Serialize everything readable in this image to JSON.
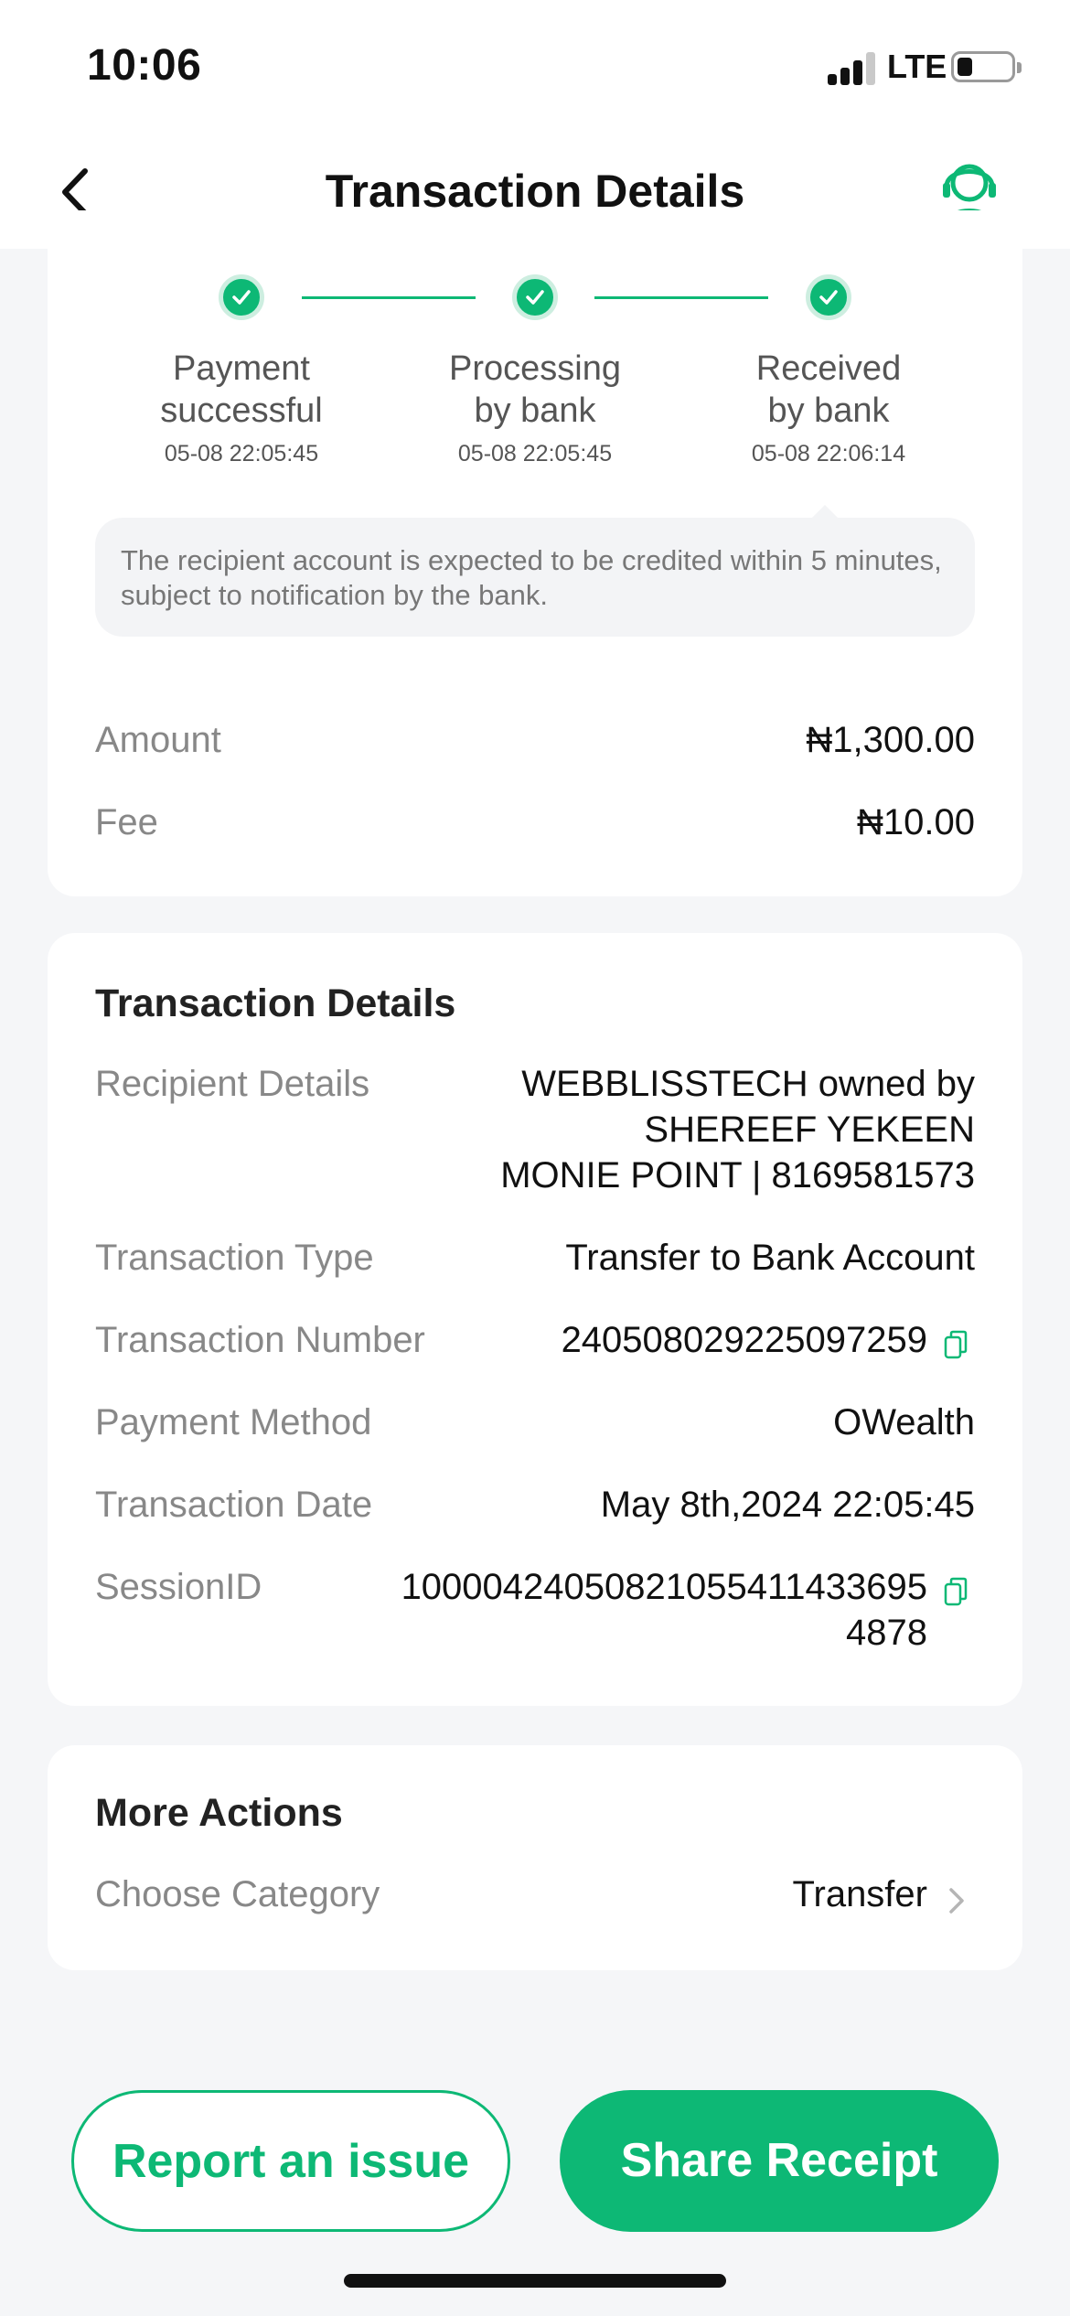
{
  "status_bar": {
    "time": "10:06",
    "network": "LTE",
    "icons": [
      "signal-icon",
      "battery-icon"
    ]
  },
  "header": {
    "title": "Transaction Details",
    "icons": [
      "back-chevron-icon",
      "customer-support-icon"
    ]
  },
  "progress": {
    "steps": [
      {
        "label": "Payment\nsuccessful",
        "time": "05-08 22:05:45",
        "icon": "check-icon"
      },
      {
        "label": "Processing\nby bank",
        "time": "05-08 22:05:45",
        "icon": "check-icon"
      },
      {
        "label": "Received\nby bank",
        "time": "05-08 22:06:14",
        "icon": "check-icon"
      }
    ],
    "note": "The recipient account is expected to be credited within 5 minutes, subject to notification by the bank."
  },
  "summary": {
    "amount_label": "Amount",
    "amount_value": "₦1,300.00",
    "fee_label": "Fee",
    "fee_value": "₦10.00"
  },
  "details": {
    "title": "Transaction Details",
    "recipient_label": "Recipient Details",
    "recipient_line1": "WEBBLISSTECH owned by",
    "recipient_line2": "SHEREEF YEKEEN",
    "recipient_line3": "MONIE POINT | 8169581573",
    "type_label": "Transaction Type",
    "type_value": "Transfer to Bank Account",
    "number_label": "Transaction Number",
    "number_value": "240508029225097259",
    "method_label": "Payment Method",
    "method_value": "OWealth",
    "date_label": "Transaction Date",
    "date_value": "May 8th,2024 22:05:45",
    "session_label": "SessionID",
    "session_line1": "100004240508210554114336​95",
    "session_line2": "4878"
  },
  "more_actions": {
    "title": "More Actions",
    "category_label": "Choose Category",
    "category_value": "Transfer"
  },
  "buttons": {
    "report": "Report an issue",
    "share": "Share Receipt"
  },
  "colors": {
    "accent": "#0db875",
    "background": "#f5f6f8",
    "card": "#ffffff",
    "muted_text": "#888888"
  }
}
